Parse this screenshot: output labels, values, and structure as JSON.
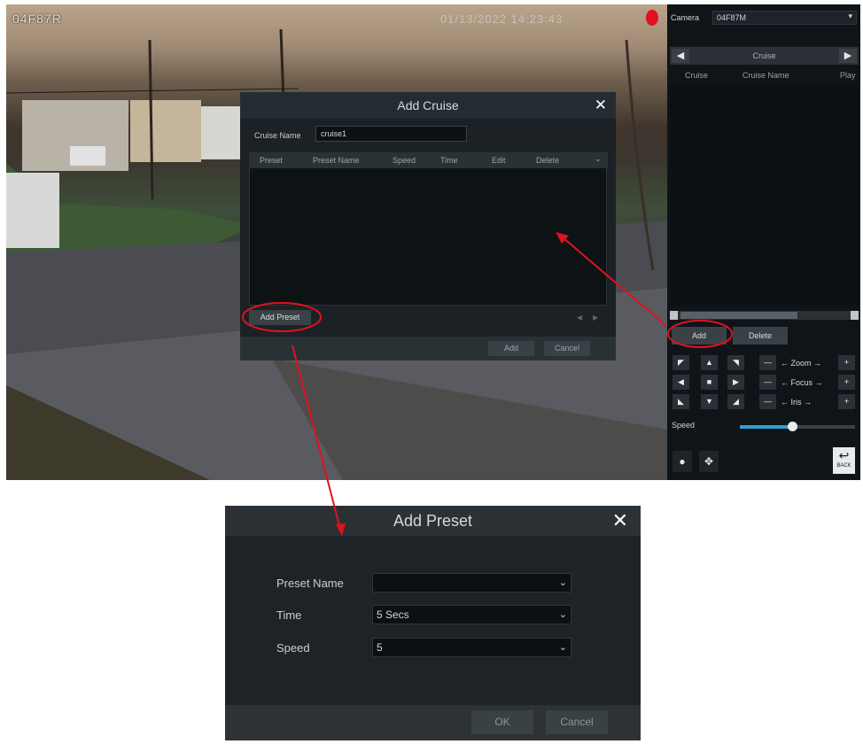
{
  "camera_view": {
    "label": "04F87R",
    "timestamp": "01/13/2022 14:23:43"
  },
  "panel": {
    "camera_label": "Camera",
    "camera_value": "04F87M",
    "tab_title": "Cruise",
    "columns": [
      "Cruise",
      "Cruise Name",
      "Play"
    ],
    "add_label": "Add",
    "delete_label": "Delete",
    "zoom_label": "Zoom",
    "focus_label": "Focus",
    "iris_label": "Iris",
    "speed_label": "Speed",
    "speed_level": 0.45,
    "back_label": "BACK"
  },
  "add_cruise": {
    "title": "Add Cruise",
    "cruise_name_label": "Cruise Name",
    "cruise_name_value": "cruise1",
    "columns": [
      "Preset",
      "Preset Name",
      "Speed",
      "Time",
      "Edit",
      "Delete"
    ],
    "add_preset_label": "Add Preset",
    "add_label": "Add",
    "cancel_label": "Cancel"
  },
  "add_preset": {
    "title": "Add Preset",
    "preset_name_label": "Preset Name",
    "preset_name_value": "",
    "time_label": "Time",
    "time_value": "5 Secs",
    "speed_label": "Speed",
    "speed_value": "5",
    "ok_label": "OK",
    "cancel_label": "Cancel"
  },
  "colors": {
    "annotation": "#e0121f",
    "accent": "#2f9fd6"
  }
}
